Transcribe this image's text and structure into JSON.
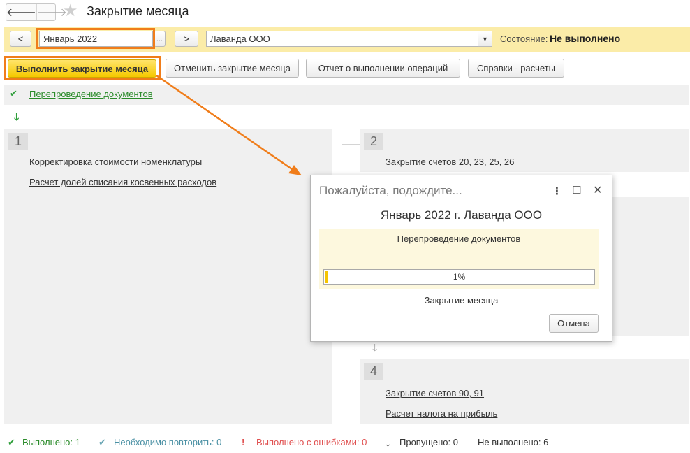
{
  "window": {
    "title": "Закрытие месяца"
  },
  "period_bar": {
    "prev_label": "<",
    "period_value": "Январь 2022",
    "choose_label": "...",
    "next_label": ">",
    "organization_value": "Лаванда ООО",
    "status_label": "Состояние:",
    "status_value": "Не выполнено"
  },
  "toolbar": {
    "run_label": "Выполнить закрытие месяца",
    "cancel_label": "Отменить закрытие месяца",
    "report_label": "Отчет о выполнении операций",
    "reference_label": "Справки - расчеты"
  },
  "steps": {
    "repost_label": "Перепроведение документов",
    "block1": {
      "number": "1",
      "items": [
        "Корректировка стоимости номенклатуры",
        "Расчет долей списания косвенных расходов"
      ]
    },
    "block2": {
      "number": "2",
      "items": [
        "Закрытие счетов 20, 23, 25, 26"
      ]
    },
    "block4": {
      "number": "4",
      "items": [
        "Закрытие счетов 90, 91",
        "Расчет налога на прибыль"
      ]
    }
  },
  "dialog": {
    "title": "Пожалуйста, подождите...",
    "subtitle": "Январь 2022 г. Лаванда ООО",
    "operation": "Перепроведение документов",
    "progress_text": "1%",
    "progress_fraction": 0.01,
    "stage": "Закрытие месяца",
    "cancel_label": "Отмена"
  },
  "footer": {
    "done_label": "Выполнено:",
    "done_count": "1",
    "repeat_label": "Необходимо повторить:",
    "repeat_count": "0",
    "errors_label": "Выполнено с ошибками:",
    "errors_count": "0",
    "skipped_label": "Пропущено:",
    "skipped_count": "0",
    "notdone_label": "Не выполнено:",
    "notdone_count": "6"
  },
  "colors": {
    "accent_yellow": "#f5c900",
    "highlight_orange": "#f07d1a",
    "status_green": "#2a8b2a",
    "status_red": "#e05050",
    "status_teal": "#4a90a4"
  }
}
